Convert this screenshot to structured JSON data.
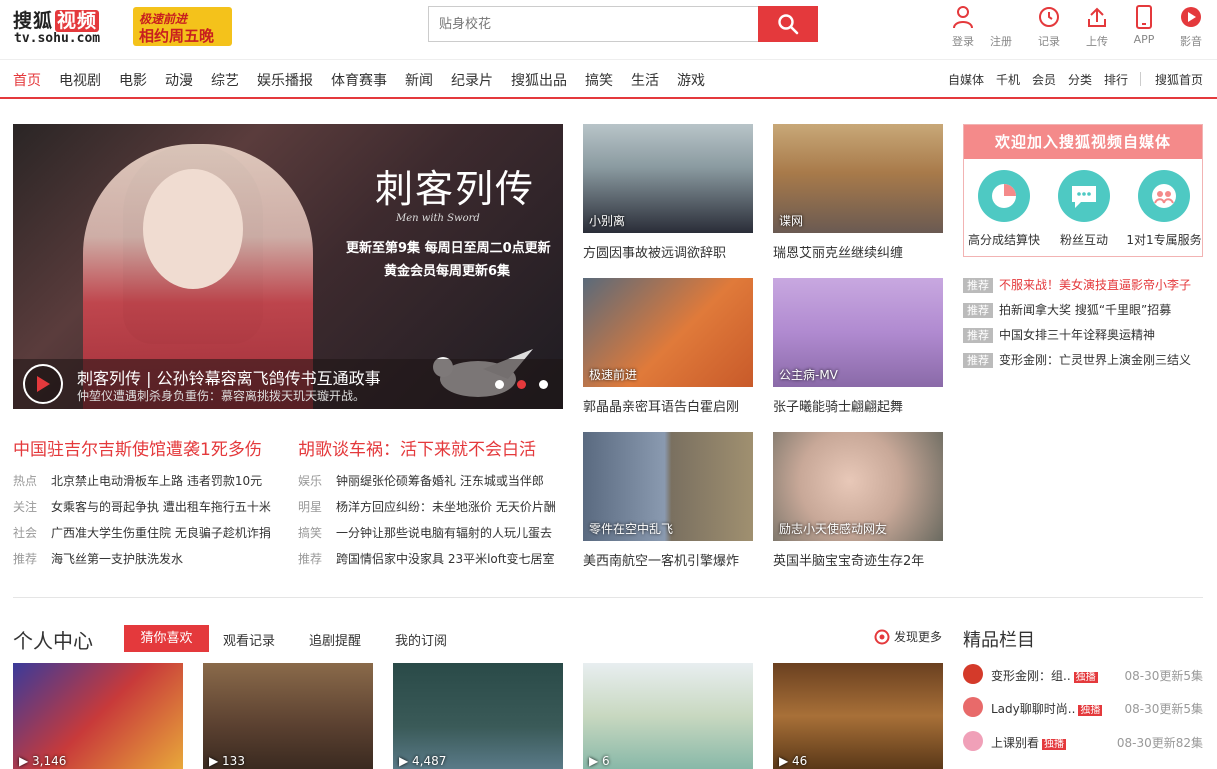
{
  "header": {
    "logo_text": "搜狐",
    "logo_badge": "视频",
    "logo_domain": "tv.sohu.com",
    "promo_line1": "极速前进",
    "promo_line2": "相约周五晚",
    "search_placeholder": "贴身校花",
    "tools": [
      {
        "label": "登录",
        "icon": "user-icon"
      },
      {
        "label": "注册",
        "icon": ""
      },
      {
        "label": "记录",
        "icon": "history-icon"
      },
      {
        "label": "上传",
        "icon": "upload-icon"
      },
      {
        "label": "APP",
        "icon": "phone-icon"
      },
      {
        "label": "影音",
        "icon": "play-circle-icon"
      }
    ]
  },
  "nav": {
    "items": [
      "首页",
      "电视剧",
      "电影",
      "动漫",
      "综艺",
      "娱乐播报",
      "体育赛事",
      "新闻",
      "纪录片",
      "搜狐出品",
      "搞笑",
      "生活",
      "游戏"
    ],
    "right_items": [
      "自媒体",
      "千机",
      "会员",
      "分类",
      "排行"
    ],
    "home_link": "搜狐首页"
  },
  "hero": {
    "calligraphy": "刺客列传",
    "calligraphy_sub": "Men with Sword",
    "promo_line1": "更新至第9集 每周日至周二0点更新",
    "promo_line2": "黄金会员每周更新6集",
    "title": "刺客列传 | 公孙铃幕容离飞鸽传书互通政事",
    "subtitle": "仲堃仪遭遇刺杀身负重伤：慕容离挑拨天玑天璇开战。"
  },
  "tiles": [
    {
      "tag": "小别离",
      "caption": "方圆因事故被远调欲辞职"
    },
    {
      "tag": "谍网",
      "caption": "瑞恩艾丽克丝继续纠缠"
    },
    {
      "tag": "极速前进",
      "caption": "郭晶晶亲密耳语告白霍启刚"
    },
    {
      "tag": "公主病-MV",
      "caption": "张子曦能骑士翩翩起舞"
    },
    {
      "tag": "零件在空中乱飞",
      "caption": "美西南航空一客机引擎爆炸"
    },
    {
      "tag": "励志小天使感动网友",
      "caption": "英国半脑宝宝奇迹生存2年"
    }
  ],
  "ad": {
    "heading": "欢迎加入搜狐视频自媒体",
    "items": [
      "高分成结算快",
      "粉丝互动",
      "1对1专属服务"
    ]
  },
  "recommend": {
    "badge": "推荐",
    "items": [
      "不服来战！美女演技直逼影帝小李子",
      "拍新闻拿大奖 搜狐“千里眼”招募",
      "中国女排三十年诠释奥运精神",
      "变形金刚：亡灵世界上演金刚三结义"
    ]
  },
  "news_left": {
    "headline": "中国驻吉尔吉斯使馆遭袭1死多伤",
    "items": [
      {
        "cat": "热点",
        "text": "北京禁止电动滑板车上路 违者罚款10元"
      },
      {
        "cat": "关注",
        "text": "女乘客与的哥起争执 遭出租车拖行五十米"
      },
      {
        "cat": "社会",
        "text": "广西准大学生伤重住院 无良骗子趁机诈捐"
      },
      {
        "cat": "推荐",
        "text": "海飞丝第一支护肤洗发水"
      }
    ]
  },
  "news_right": {
    "headline": "胡歌谈车祸：活下来就不会白活",
    "items": [
      {
        "cat": "娱乐",
        "text": "钟丽缇张伦硕筹备婚礼 汪东城或当伴郎"
      },
      {
        "cat": "明星",
        "text": "杨洋方回应纠纷：未坐地涨价 无天价片酬"
      },
      {
        "cat": "搞笑",
        "text": "一分钟让那些说电脑有辐射的人玩儿蛋去"
      },
      {
        "cat": "推荐",
        "text": "跨国情侣家中没家具 23平米loft变七居室"
      }
    ]
  },
  "personal": {
    "title": "个人中心",
    "tabs": [
      "猜你喜欢",
      "观看记录",
      "追剧提醒",
      "我的订阅"
    ],
    "more": "发现更多",
    "thumbs": [
      "3,146",
      "133",
      "4,487",
      "6",
      "46"
    ]
  },
  "columns": {
    "title": "精品栏目",
    "exclusive": "独播",
    "items": [
      {
        "name": "变形金刚：组..",
        "update": "08-30更新5集"
      },
      {
        "name": "Lady聊聊时尚..",
        "update": "08-30更新5集"
      },
      {
        "name": "上课别看",
        "update": "08-30更新82集"
      }
    ]
  },
  "colors": {
    "accent": "#e4393c",
    "ad_pink": "#f48a8a",
    "ad_teal": "#4ec9c3"
  }
}
